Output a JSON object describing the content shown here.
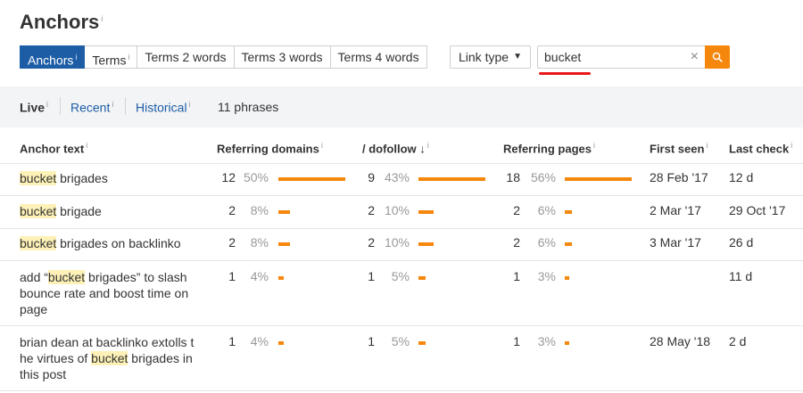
{
  "page": {
    "title": "Anchors",
    "info_glyph": "i"
  },
  "tabs": [
    {
      "label": "Anchors",
      "has_info": true,
      "active": true
    },
    {
      "label": "Terms",
      "has_info": true,
      "active": false
    },
    {
      "label": "Terms 2 words",
      "has_info": false,
      "active": false
    },
    {
      "label": "Terms 3 words",
      "has_info": false,
      "active": false
    },
    {
      "label": "Terms 4 words",
      "has_info": false,
      "active": false
    }
  ],
  "link_type": {
    "label": "Link type",
    "caret": "▼"
  },
  "search": {
    "value": "bucket",
    "clear_icon": "×"
  },
  "filter": {
    "live": "Live",
    "recent": "Recent",
    "historical": "Historical",
    "count": "11 phrases"
  },
  "columns": {
    "anchor": "Anchor text",
    "ref_domains": "Referring domains",
    "dofollow": "/ dofollow",
    "dofollow_sort": "↓",
    "ref_pages": "Referring pages",
    "first_seen": "First seen",
    "last_check": "Last check"
  },
  "highlight_term": "bucket",
  "rows": [
    {
      "anchor_parts": [
        [
          "bucket",
          true
        ],
        [
          " brigades",
          false
        ]
      ],
      "rd": "12",
      "rd_pct": "50%",
      "rd_frac": 1.0,
      "df": "9",
      "df_pct": "43%",
      "df_frac": 1.0,
      "rp": "18",
      "rp_pct": "56%",
      "rp_frac": 1.0,
      "first_seen": "28 Feb '17",
      "last_check": "12 d"
    },
    {
      "anchor_parts": [
        [
          "bucket",
          true
        ],
        [
          " brigade",
          false
        ]
      ],
      "rd": "2",
      "rd_pct": "8%",
      "rd_frac": 0.17,
      "df": "2",
      "df_pct": "10%",
      "df_frac": 0.22,
      "rp": "2",
      "rp_pct": "6%",
      "rp_frac": 0.11,
      "first_seen": "2 Mar '17",
      "last_check": "29 Oct '17"
    },
    {
      "anchor_parts": [
        [
          "bucket",
          true
        ],
        [
          " brigades on backlinko",
          false
        ]
      ],
      "rd": "2",
      "rd_pct": "8%",
      "rd_frac": 0.17,
      "df": "2",
      "df_pct": "10%",
      "df_frac": 0.22,
      "rp": "2",
      "rp_pct": "6%",
      "rp_frac": 0.11,
      "first_seen": "3 Mar '17",
      "last_check": "26 d"
    },
    {
      "anchor_parts": [
        [
          "add “",
          false
        ],
        [
          "bucket",
          true
        ],
        [
          " brigades” to slash bounce rate and boost time on page",
          false
        ]
      ],
      "rd": "1",
      "rd_pct": "4%",
      "rd_frac": 0.08,
      "df": "1",
      "df_pct": "5%",
      "df_frac": 0.11,
      "rp": "1",
      "rp_pct": "3%",
      "rp_frac": 0.06,
      "first_seen": "",
      "last_check": "11 d"
    },
    {
      "anchor_parts": [
        [
          "brian dean at backlinko extolls t he virtues of ",
          false
        ],
        [
          "bucket",
          true
        ],
        [
          " brigades in this post",
          false
        ]
      ],
      "rd": "1",
      "rd_pct": "4%",
      "rd_frac": 0.08,
      "df": "1",
      "df_pct": "5%",
      "df_frac": 0.11,
      "rp": "1",
      "rp_pct": "3%",
      "rp_frac": 0.06,
      "first_seen": "28 May '18",
      "last_check": "2 d"
    }
  ],
  "colors": {
    "accent": "#1d5da6",
    "bar": "#f5870c",
    "highlight": "#fdf1b7",
    "underline": "#e81818",
    "filterbar": "#f3f4f6"
  }
}
